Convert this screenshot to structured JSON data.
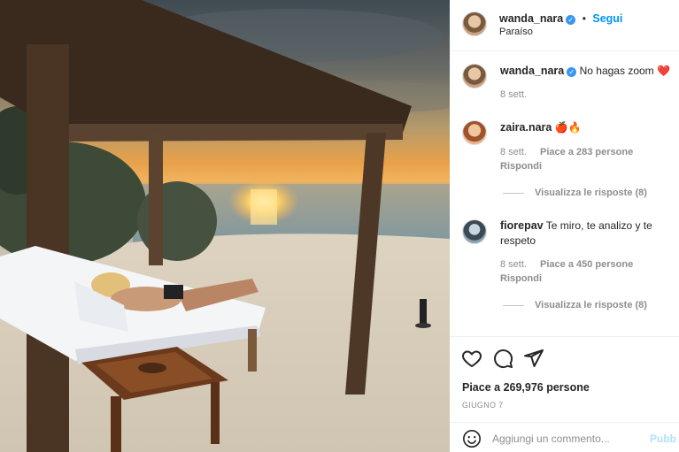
{
  "header": {
    "username": "wanda_nara",
    "follow_label": "Segui",
    "location": "Paraíso"
  },
  "comments": [
    {
      "username": "wanda_nara",
      "text": "No hagas zoom",
      "emoji": "❤️",
      "time": "8 sett."
    },
    {
      "username": "zaira.nara",
      "text": "",
      "emoji": "🍎🔥",
      "time": "8 sett.",
      "likes": "Piace a 283 persone",
      "reply": "Rispondi",
      "view_replies": "Visualizza le risposte (8)"
    },
    {
      "username": "fiorepav",
      "text": "Te miro, te analizo y te respeto",
      "time": "8 sett.",
      "likes": "Piace a 450 persone",
      "reply": "Rispondi",
      "view_replies": "Visualizza le risposte (8)"
    }
  ],
  "actions": {
    "likes_total": "Piace a 269,976 persone",
    "date": "GIUGNO 7"
  },
  "add_comment": {
    "placeholder": "Aggiungi un commento...",
    "publish_label": "Pubb"
  },
  "icons": [
    "heart-icon",
    "comment-icon",
    "share-icon",
    "emoji-icon",
    "verified-icon"
  ],
  "colors": {
    "accent": "#0095f6",
    "verified": "#3897f0",
    "muted": "#8e8e8e"
  }
}
